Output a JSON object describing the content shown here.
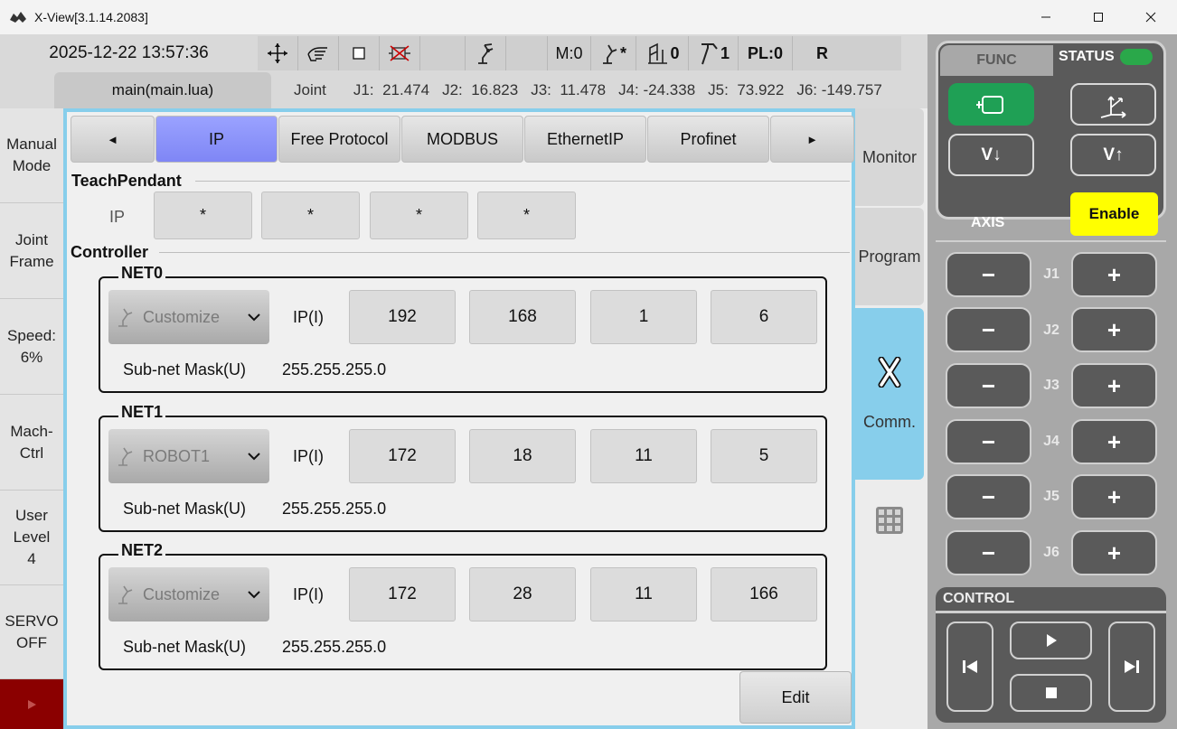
{
  "window": {
    "title": "X-View[3.1.14.2083]"
  },
  "header": {
    "datetime": "2025-12-22 13:57:36",
    "toolbar": {
      "m_value": "M:0",
      "robot_star": "*",
      "coord_value": "0",
      "tool_value": "1",
      "pl_value": "PL:0",
      "r_label": "R"
    },
    "script_tab": "main(main.lua)",
    "joint_mode": "Joint",
    "joints": [
      {
        "label": "J1:",
        "value": "21.474"
      },
      {
        "label": "J2:",
        "value": "16.823"
      },
      {
        "label": "J3:",
        "value": "11.478"
      },
      {
        "label": "J4:",
        "value": "-24.338"
      },
      {
        "label": "J5:",
        "value": "73.922"
      },
      {
        "label": "J6:",
        "value": "-149.757"
      }
    ]
  },
  "left_sidebar": {
    "items": [
      "Manual\nMode",
      "Joint\nFrame",
      "Speed:\n6%",
      "Mach-\nCtrl",
      "User\nLevel\n4",
      "SERVO\nOFF"
    ]
  },
  "main": {
    "tabs": {
      "prev": "◄",
      "items": [
        "IP",
        "Free Protocol",
        "MODBUS",
        "EthernetIP",
        "Profinet"
      ],
      "next": "►",
      "active": "IP"
    },
    "teach_pendant": {
      "title": "TeachPendant",
      "ip_label": "IP",
      "ip": [
        "*",
        "*",
        "*",
        "*"
      ]
    },
    "controller": {
      "title": "Controller",
      "nets": [
        {
          "name": "NET0",
          "mode": "Customize",
          "ip_label": "IP(I)",
          "ip": [
            "192",
            "168",
            "1",
            "6"
          ],
          "mask_label": "Sub-net Mask(U)",
          "mask": "255.255.255.0"
        },
        {
          "name": "NET1",
          "mode": "ROBOT1",
          "ip_label": "IP(I)",
          "ip": [
            "172",
            "18",
            "11",
            "5"
          ],
          "mask_label": "Sub-net Mask(U)",
          "mask": "255.255.255.0"
        },
        {
          "name": "NET2",
          "mode": "Customize",
          "ip_label": "IP(I)",
          "ip": [
            "172",
            "28",
            "11",
            "166"
          ],
          "mask_label": "Sub-net Mask(U)",
          "mask": "255.255.255.0"
        }
      ]
    },
    "edit_button": "Edit"
  },
  "right_nav": {
    "items": [
      "Monitor",
      "Program",
      "Comm."
    ],
    "active": "Comm."
  },
  "func_panel": {
    "func_tab": "FUNC",
    "status_tab": "STATUS",
    "status_color": "#2aa84a",
    "buttons": {
      "v_down": "V↓",
      "v_up": "V↑"
    },
    "axis_label": "AXIS",
    "enable": "Enable",
    "jog_minus": "−",
    "jog_plus": "+",
    "axes": [
      "J1",
      "J2",
      "J3",
      "J4",
      "J5",
      "J6"
    ],
    "control_title": "CONTROL"
  },
  "colors": {
    "accent_blue": "#87ceeb",
    "active_tab": "#8c93fa",
    "enable_yellow": "#ffff00",
    "servo_red": "#8b0000",
    "func_green": "#1fa055"
  }
}
